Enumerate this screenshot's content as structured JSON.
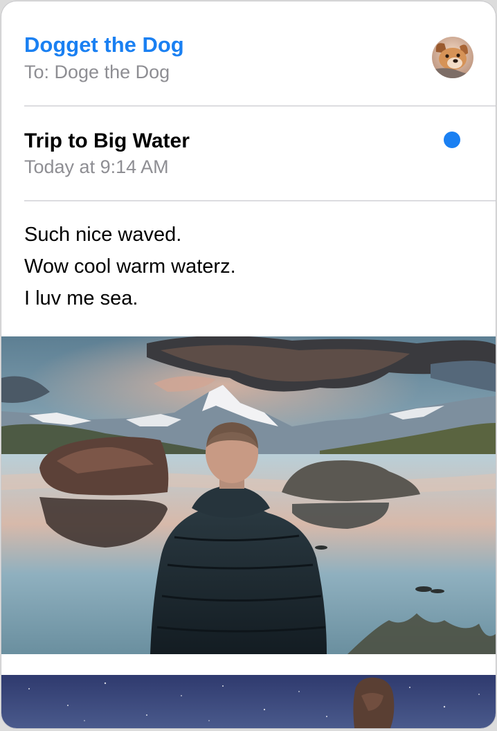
{
  "message": {
    "sender": "Dogget the Dog",
    "recipient": "To: Doge the Dog",
    "subject": "Trip to Big Water",
    "timestamp": "Today at 9:14 AM",
    "body_lines": [
      "Such nice waved.",
      "Wow cool warm waterz.",
      "I luv me sea."
    ],
    "unread": true
  },
  "colors": {
    "accent": "#1a80f2",
    "secondary_text": "#8e8e93",
    "divider": "#dcdce0"
  },
  "attachments": [
    {
      "kind": "photo",
      "subject": "person in dark jacket facing mountain lake with rocks and reflections"
    },
    {
      "kind": "photo",
      "subject": "starry night sky with rock formation (cropped)"
    }
  ]
}
